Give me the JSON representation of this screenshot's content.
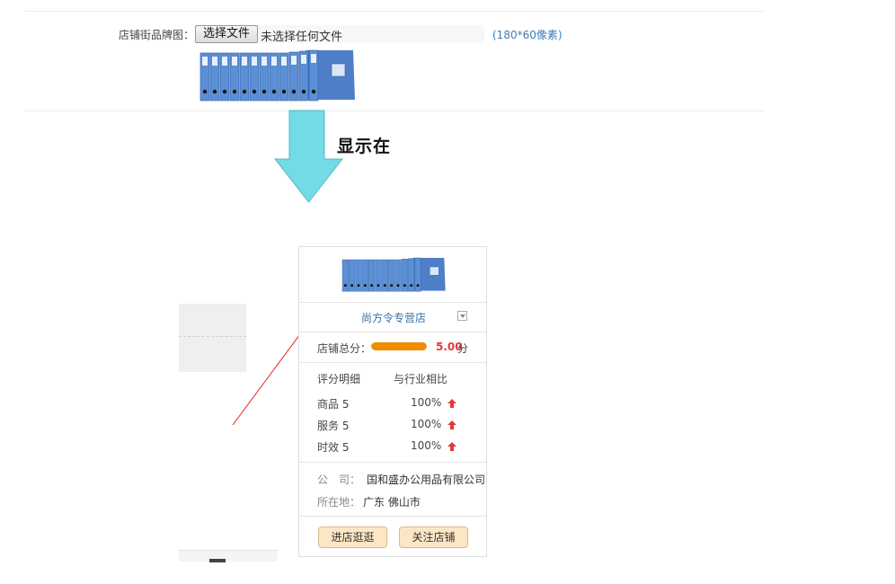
{
  "upload": {
    "label": "店铺街品牌图：",
    "button_label": "选择文件",
    "file_status": "未选择任何文件",
    "size_hint": "(180*60像素)"
  },
  "display_label": "显示在",
  "store": {
    "name": "尚方令专营店",
    "score_label": "店铺总分：",
    "score_value": "5.00",
    "score_unit": "分",
    "score_fraction": 1.0,
    "detail_header": "评分明细",
    "compare_header": "与行业相比",
    "ratings": [
      {
        "name": "商品",
        "score": "5",
        "percent": "100%"
      },
      {
        "name": "服务",
        "score": "5",
        "percent": "100%"
      },
      {
        "name": "时效",
        "score": "5",
        "percent": "100%"
      }
    ],
    "company_label": "公　司：",
    "company_value": "国和盛办公用品有限公司",
    "location_label": "所在地：",
    "location_value": "广东 佛山市",
    "visit_button": "进店逛逛",
    "follow_button": "关注店铺"
  },
  "colors": {
    "arrow_fill": "#72dbe6",
    "arrow_stroke": "#5ab4c0",
    "score_bar": "#f08c00",
    "score_value": "#e4393c",
    "link_blue": "#3b6fa5",
    "button_bg": "#fbe7c5",
    "pointer_line": "#e02020"
  }
}
